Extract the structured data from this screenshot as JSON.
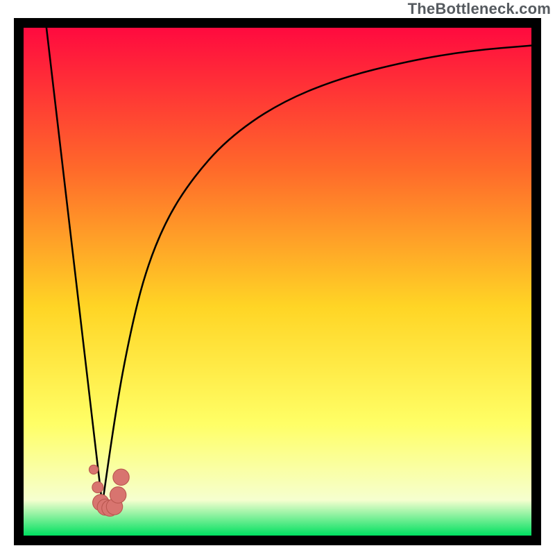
{
  "watermark_text": "TheBottleneck.com",
  "colors": {
    "gradient_top": "#ff0a3f",
    "gradient_upper_mid": "#ff6a2a",
    "gradient_mid": "#ffd525",
    "gradient_lower_mid": "#ffff66",
    "gradient_near_bottom": "#f6ffcf",
    "gradient_bottom": "#00e060",
    "frame": "#000000",
    "curve": "#000000",
    "marker_fill": "#d8746f",
    "marker_stroke": "#b9574f"
  },
  "chart_data": {
    "type": "line",
    "title": "",
    "xlabel": "",
    "ylabel": "",
    "xlim": [
      0,
      100
    ],
    "ylim": [
      0,
      100
    ],
    "annotations": [],
    "series": [
      {
        "name": "left-branch",
        "x": [
          4.5,
          15.5
        ],
        "values": [
          100,
          6
        ]
      },
      {
        "name": "right-branch",
        "x": [
          15.5,
          18,
          21,
          24,
          28,
          33,
          40,
          50,
          62,
          76,
          88,
          100
        ],
        "values": [
          6,
          24,
          40,
          52,
          62,
          70,
          78,
          85,
          90,
          93.5,
          95.5,
          96.5
        ]
      }
    ],
    "markers": {
      "name": "optimal-markers",
      "points": [
        {
          "x": 13.8,
          "y": 13,
          "r": 0.9
        },
        {
          "x": 14.6,
          "y": 9.5,
          "r": 1.1
        },
        {
          "x": 15.2,
          "y": 6.5,
          "r": 1.6
        },
        {
          "x": 16.1,
          "y": 5.6,
          "r": 1.6
        },
        {
          "x": 17.0,
          "y": 5.4,
          "r": 1.6
        },
        {
          "x": 17.9,
          "y": 5.7,
          "r": 1.6
        },
        {
          "x": 18.6,
          "y": 8.0,
          "r": 1.6
        },
        {
          "x": 19.2,
          "y": 11.5,
          "r": 1.6
        }
      ]
    }
  }
}
